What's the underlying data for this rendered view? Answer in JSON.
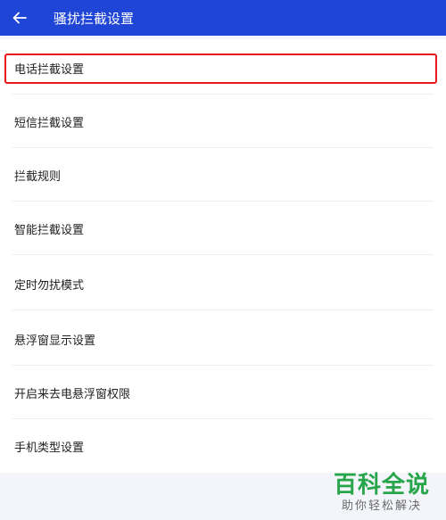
{
  "header": {
    "title": "骚扰拦截设置",
    "back_icon": "back-arrow-icon"
  },
  "items": [
    {
      "label": "电话拦截设置"
    },
    {
      "label": "短信拦截设置"
    },
    {
      "label": "拦截规则"
    },
    {
      "label": "智能拦截设置"
    },
    {
      "label": "定时勿扰模式"
    },
    {
      "label": "悬浮窗显示设置"
    },
    {
      "label": "开启来去电悬浮窗权限"
    },
    {
      "label": "手机类型设置"
    }
  ],
  "watermark": {
    "main": "百科全说",
    "sub": "助你轻松解决"
  },
  "colors": {
    "header_bg": "#1f45d6",
    "highlight_border": "#e8191c",
    "watermark_green": "#27a54a"
  }
}
